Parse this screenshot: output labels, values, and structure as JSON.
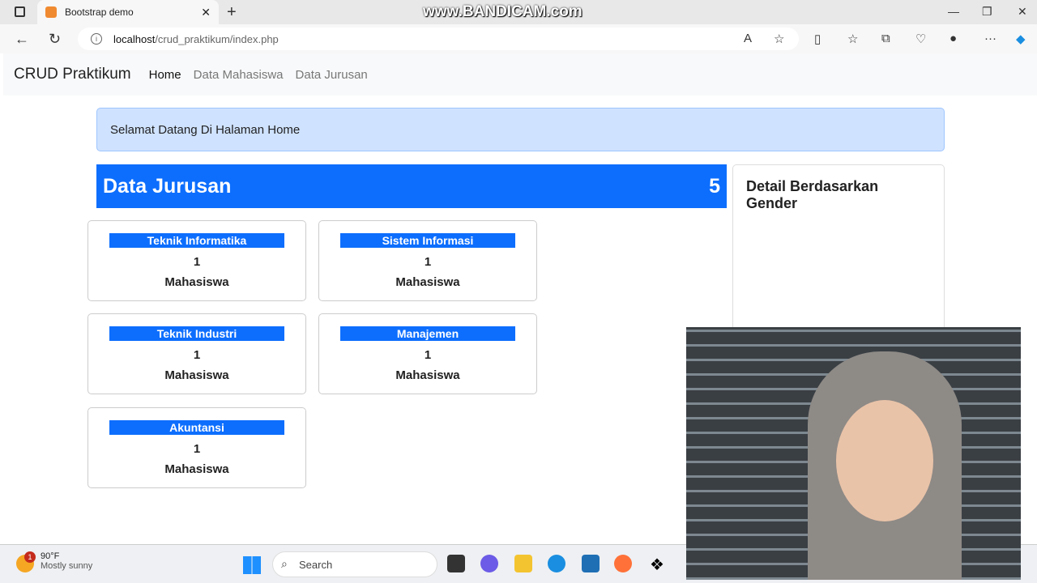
{
  "browser": {
    "tab_title": "Bootstrap demo",
    "url_host": "localhost",
    "url_path": "/crud_praktikum/index.php",
    "watermark": "www.BANDICAM.com"
  },
  "navbar": {
    "brand": "CRUD Praktikum",
    "links": [
      {
        "label": "Home"
      },
      {
        "label": "Data Mahasiswa"
      },
      {
        "label": "Data Jurusan"
      }
    ]
  },
  "alert": "Selamat Datang Di Halaman Home",
  "jurusan": {
    "title": "Data Jurusan",
    "count": "5",
    "items": [
      {
        "name": "Teknik Informatika",
        "count": "1",
        "unit": "Mahasiswa"
      },
      {
        "name": "Sistem Informasi",
        "count": "1",
        "unit": "Mahasiswa"
      },
      {
        "name": "Teknik Industri",
        "count": "1",
        "unit": "Mahasiswa"
      },
      {
        "name": "Manajemen",
        "count": "1",
        "unit": "Mahasiswa"
      },
      {
        "name": "Akuntansi",
        "count": "1",
        "unit": "Mahasiswa"
      }
    ]
  },
  "gender": {
    "title": "Detail Berdasarkan Gender"
  },
  "taskbar": {
    "temp": "90°F",
    "weather": "Mostly sunny",
    "badge": "1",
    "search": "Search"
  },
  "colors": {
    "primary": "#0d6efd",
    "alert_bg": "#cfe2ff"
  }
}
